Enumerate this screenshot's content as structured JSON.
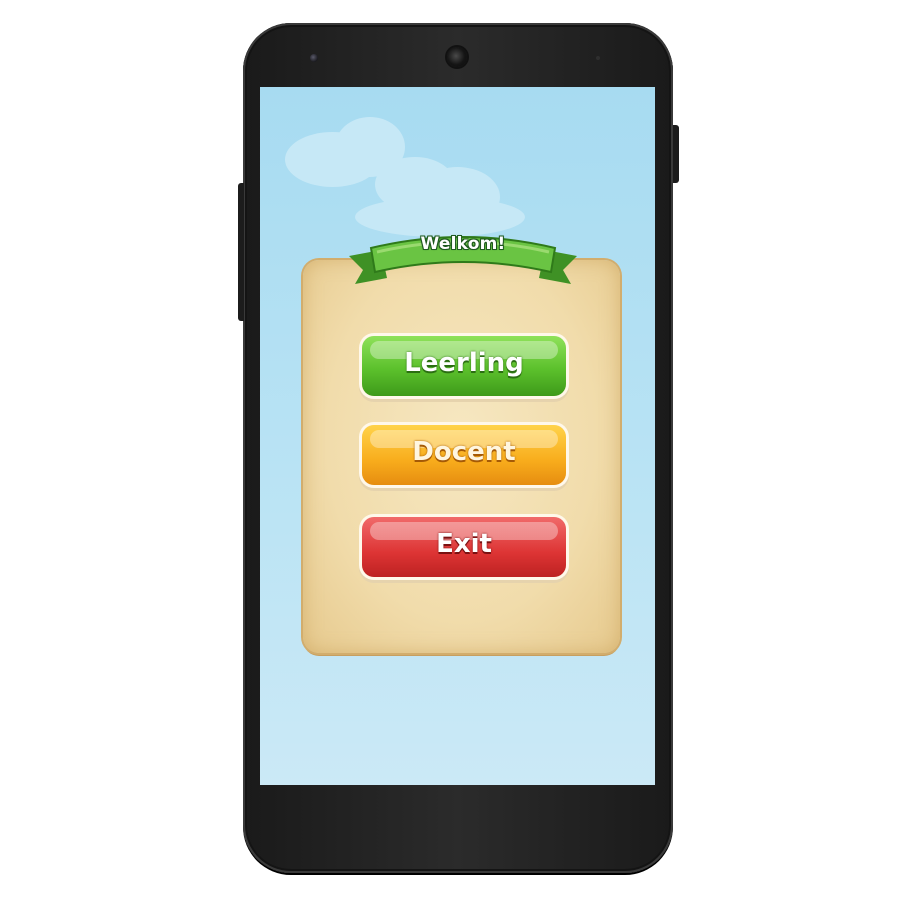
{
  "screen": {
    "ribbon_title": "Welkom!",
    "buttons": {
      "student_label": "Leerling",
      "teacher_label": "Docent",
      "exit_label": "Exit"
    }
  },
  "colors": {
    "sky": "#a7dbf1",
    "parchment": "#f1dcab",
    "ribbon_green": "#5cb53a",
    "button_green": "#5cc12c",
    "button_orange": "#f8ac1c",
    "button_red": "#dd3434"
  }
}
